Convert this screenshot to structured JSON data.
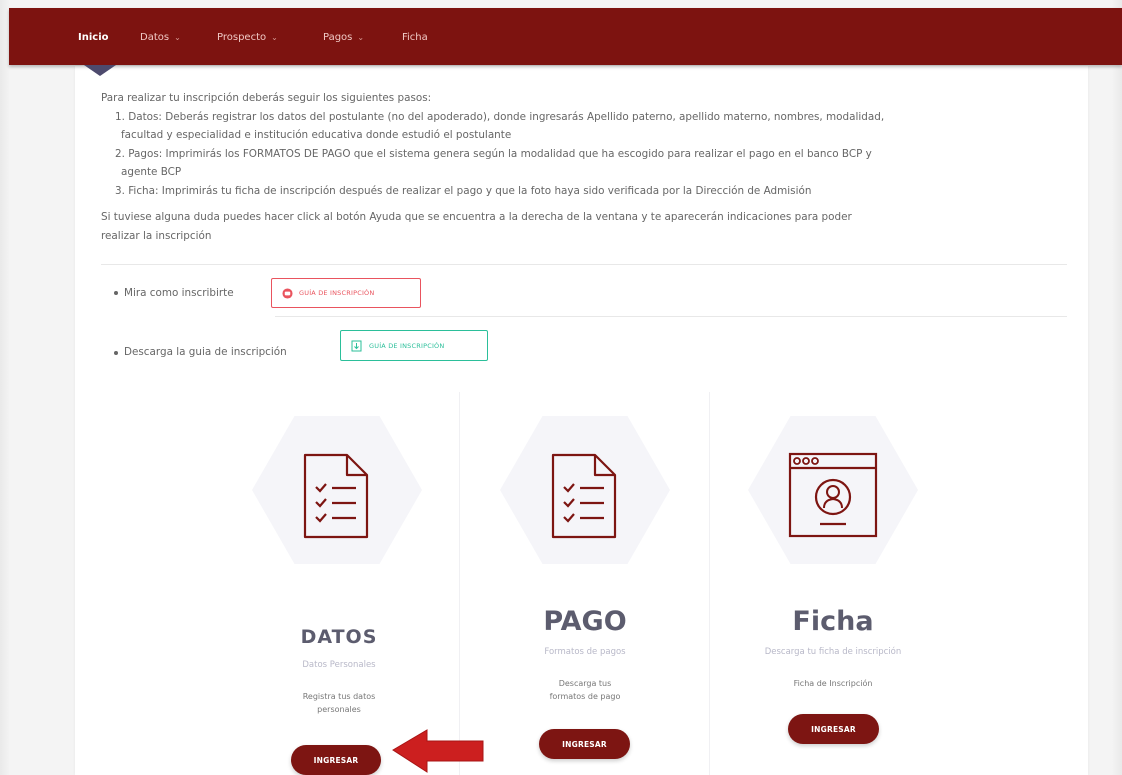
{
  "nav": {
    "items": [
      {
        "label": "Inicio",
        "dropdown": false,
        "active": true
      },
      {
        "label": "Datos",
        "dropdown": true,
        "active": false
      },
      {
        "label": "Prospecto",
        "dropdown": true,
        "active": false
      },
      {
        "label": "Pagos",
        "dropdown": true,
        "active": false
      },
      {
        "label": "Ficha",
        "dropdown": false,
        "active": false
      }
    ],
    "caret": "⌄"
  },
  "instructions": {
    "intro": "Para realizar tu inscripción deberás seguir los siguientes pasos:",
    "step1_line1": "1. Datos: Deberás registrar los datos del postulante (no del apoderado), donde ingresarás Apellido paterno, apellido materno, nombres, modalidad,",
    "step1_line2": "facultad y especialidad e institución educativa donde estudió el postulante",
    "step2_line1": "2. Pagos: Imprimirás los FORMATOS DE PAGO que el sistema genera según la modalidad que ha escogido para realizar el pago en el banco BCP y",
    "step2_line2": "agente BCP",
    "step3": "3. Ficha: Imprimirás tu ficha de inscripción después de realizar el pago y que la foto haya sido verificada por la Dirección de Admisión",
    "help_line1": "Si tuviese alguna duda puedes hacer click al botón Ayuda que se encuentra a la derecha de la ventana y te aparecerán indicaciones para poder",
    "help_line2": "realizar la inscripción"
  },
  "guides": {
    "watch_label": "Mira como inscribirte",
    "watch_button": "GUÍA DE INSCRIPCIÓN",
    "download_label": "Descarga la guia de inscripción",
    "download_button": "GUÍA DE INSCRIPCIÓN"
  },
  "steps": [
    {
      "title": "DATOS",
      "subtitle": "Datos Personales",
      "description": "Registra tus datos personales",
      "button": "INGRESAR",
      "icon": "checklist-icon"
    },
    {
      "title": "PAGO",
      "subtitle": "Formatos de pagos",
      "description": "Descarga tus formatos de pago",
      "button": "INGRESAR",
      "icon": "checklist-icon"
    },
    {
      "title": "Ficha",
      "subtitle": "Descarga tu ficha de inscripción",
      "description": "Ficha de Inscripción",
      "button": "INGRESAR",
      "icon": "profile-window-icon"
    }
  ],
  "colors": {
    "brand": "#7d1310",
    "button": "#7d1512",
    "accent_red": "#e9545e",
    "accent_green": "#2bbf9a",
    "arrow": "#cc1f1f"
  }
}
